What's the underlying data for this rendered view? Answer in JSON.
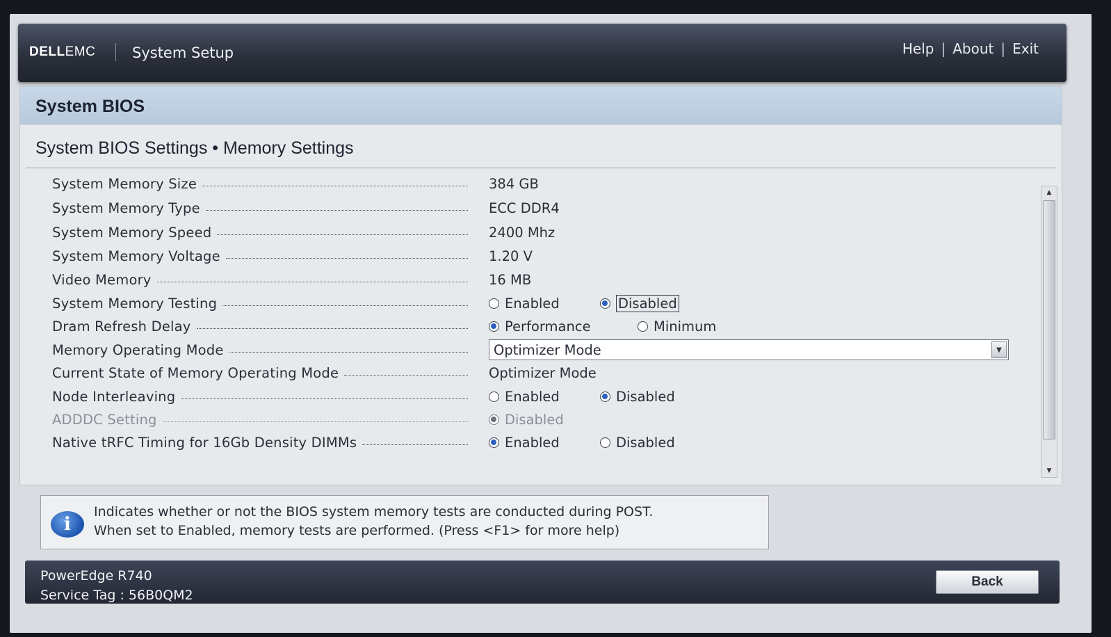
{
  "header": {
    "logo_dell": "DELL",
    "logo_emc": "EMC",
    "app_title": "System Setup",
    "links": [
      "Help",
      "About",
      "Exit"
    ],
    "separator": "|"
  },
  "panel": {
    "title": "System BIOS",
    "section_title": "System BIOS Settings • Memory Settings"
  },
  "settings": [
    {
      "label": "System Memory Size",
      "value": "384 GB"
    },
    {
      "label": "System Memory Type",
      "value": "ECC DDR4"
    },
    {
      "label": "System Memory Speed",
      "value": "2400 Mhz"
    },
    {
      "label": "System Memory Voltage",
      "value": "1.20 V"
    },
    {
      "label": "Video Memory",
      "value": "16 MB"
    },
    {
      "label": "System Memory Testing",
      "options": [
        "Enabled",
        "Disabled"
      ],
      "selected": "Disabled"
    },
    {
      "label": "Dram Refresh Delay",
      "options": [
        "Performance",
        "Minimum"
      ],
      "selected": "Performance"
    },
    {
      "label": "Memory Operating Mode",
      "select_value": "Optimizer Mode"
    },
    {
      "label": "Current State of Memory Operating Mode",
      "value": "Optimizer Mode"
    },
    {
      "label": "Node Interleaving",
      "options": [
        "Enabled",
        "Disabled"
      ],
      "selected": "Disabled"
    },
    {
      "label": "ADDDC Setting",
      "options": [
        "Disabled"
      ],
      "selected": "Disabled",
      "disabled": true
    },
    {
      "label": "Native tRFC Timing for 16Gb Density DIMMs",
      "options": [
        "Enabled",
        "Disabled"
      ],
      "selected": "Enabled"
    }
  ],
  "help": {
    "icon": "info-icon",
    "icon_glyph": "i",
    "line1": "Indicates whether or not the BIOS system memory tests are conducted during POST.",
    "line2": "When set to Enabled, memory tests are performed. (Press <F1> for more help)"
  },
  "footer": {
    "model": "PowerEdge R740",
    "service_tag": "Service Tag : 56B0QM2",
    "back_label": "Back"
  },
  "colors": {
    "header_bar": "#2b303c",
    "panel_header": "#c9d8e8",
    "radio_selected": "#2b5fbf",
    "info_icon": "#1c55b0"
  }
}
